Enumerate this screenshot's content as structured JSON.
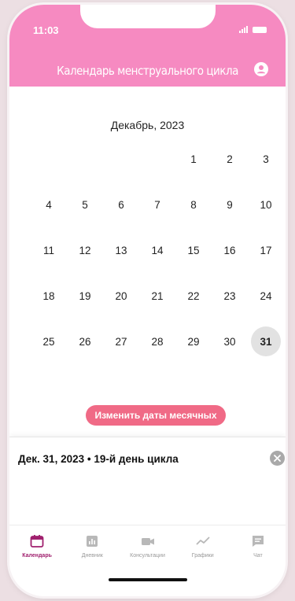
{
  "status": {
    "time": "11:03"
  },
  "header": {
    "title": "Календарь менструального цикла"
  },
  "calendar": {
    "month": "Декабрь, 2023",
    "weeks": [
      [
        "",
        "",
        "",
        "",
        "1",
        "2",
        "3"
      ],
      [
        "4",
        "5",
        "6",
        "7",
        "8",
        "9",
        "10"
      ],
      [
        "11",
        "12",
        "13",
        "14",
        "15",
        "16",
        "17"
      ],
      [
        "18",
        "19",
        "20",
        "21",
        "22",
        "23",
        "24"
      ],
      [
        "25",
        "26",
        "27",
        "28",
        "29",
        "30",
        "31"
      ]
    ],
    "selected_day": "31"
  },
  "edit_button": {
    "label": "Изменить даты месячных"
  },
  "detail": {
    "text": "Дек. 31, 2023 • 19-й день цикла"
  },
  "tabs": [
    {
      "label": "Календарь",
      "icon": "calendar-icon",
      "active": true
    },
    {
      "label": "Дневник",
      "icon": "chart-bar-icon",
      "active": false
    },
    {
      "label": "Консультации",
      "icon": "video-icon",
      "active": false
    },
    {
      "label": "Графики",
      "icon": "trend-icon",
      "active": false
    },
    {
      "label": "Чат",
      "icon": "chat-icon",
      "active": false
    }
  ],
  "colors": {
    "header": "#f68ac1",
    "button": "#f06a86",
    "active_tab": "#a0206e"
  }
}
